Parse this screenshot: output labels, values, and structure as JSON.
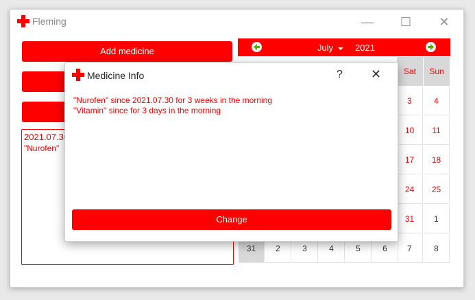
{
  "window": {
    "title": "Fleming",
    "controls": {
      "minimize": "—",
      "maximize": "☐",
      "close": "✕"
    }
  },
  "left": {
    "add_medicine_label": "Add medicine",
    "list_date": "2021.07.30",
    "list_item": "\"Nurofen\""
  },
  "calendar": {
    "month": "July",
    "year": "2021",
    "visible_weekdays": [
      "Sat",
      "Sun"
    ],
    "visible_days": [
      {
        "label": "3"
      },
      {
        "label": "4"
      },
      {
        "label": "10"
      },
      {
        "label": "11"
      },
      {
        "label": "17"
      },
      {
        "label": "18"
      },
      {
        "label": "24"
      },
      {
        "label": "25"
      },
      {
        "label": "31"
      },
      {
        "label": "1"
      }
    ],
    "last_row": [
      "31",
      "2",
      "3",
      "4",
      "5",
      "6",
      "7",
      "8"
    ]
  },
  "dialog": {
    "title": "Medicine Info",
    "help": "?",
    "close": "✕",
    "lines": [
      "\"Nurofen\" since 2021.07.30 for 3 weeks in the morning",
      "\"Vitamin\" since  for 3 days in the morning"
    ],
    "change_label": "Change"
  },
  "colors": {
    "accent": "#ff0000",
    "nav_arrow": "#5aa800"
  }
}
